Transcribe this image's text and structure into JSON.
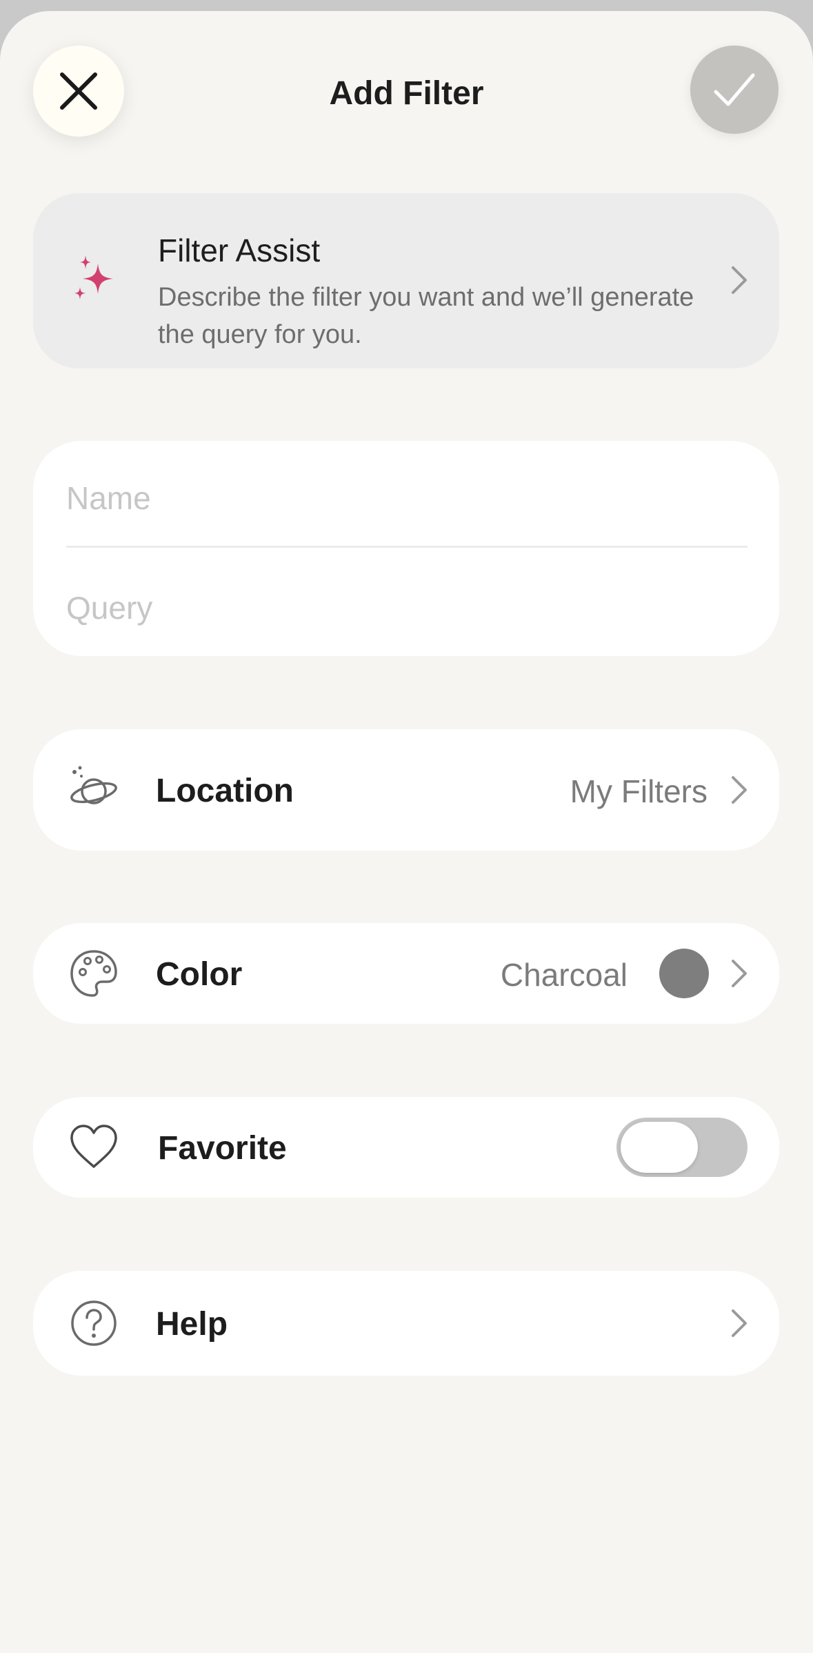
{
  "header": {
    "title": "Add Filter",
    "close_icon": "close-icon",
    "confirm_icon": "checkmark-icon"
  },
  "filter_assist": {
    "icon": "sparkles-icon",
    "title": "Filter Assist",
    "description": "Describe the filter you want and we’ll generate the query for you.",
    "accent_color": "#d2416e"
  },
  "form": {
    "name_placeholder": "Name",
    "query_placeholder": "Query"
  },
  "location": {
    "icon": "planet-icon",
    "label": "Location",
    "value": "My Filters"
  },
  "color": {
    "icon": "palette-icon",
    "label": "Color",
    "value": "Charcoal",
    "swatch": "#7e7e7e"
  },
  "favorite": {
    "icon": "heart-icon",
    "label": "Favorite",
    "enabled": false
  },
  "help": {
    "icon": "help-icon",
    "label": "Help"
  }
}
